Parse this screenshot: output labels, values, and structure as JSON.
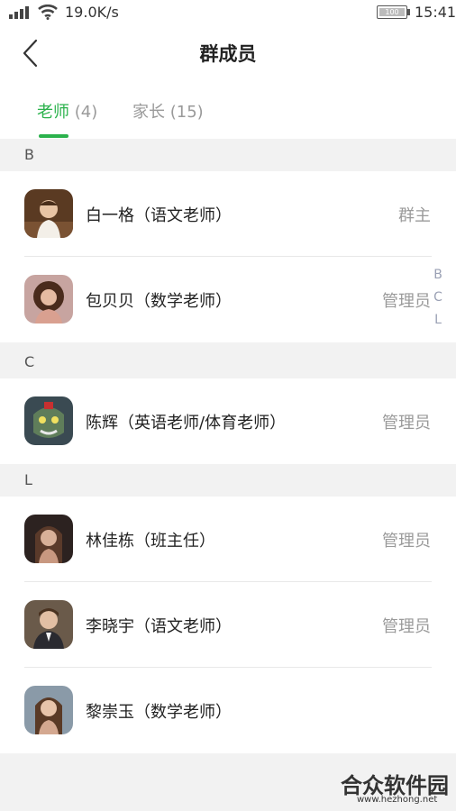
{
  "status_bar": {
    "speed": "19.0K/s",
    "battery": "100",
    "time": "15:41",
    "icons": [
      "signal-icon",
      "wifi-icon",
      "battery-icon"
    ]
  },
  "header": {
    "title": "群成员",
    "back_icon": "chevron-left-icon"
  },
  "tabs": [
    {
      "label": "老师",
      "count": "(4)",
      "active": true
    },
    {
      "label": "家长",
      "count": "(15)",
      "active": false
    }
  ],
  "sections": [
    {
      "letter": "B",
      "members": [
        {
          "name": "白一格（语文老师）",
          "role": "群主"
        },
        {
          "name": "包贝贝（数学老师）",
          "role": "管理员"
        }
      ]
    },
    {
      "letter": "C",
      "members": [
        {
          "name": "陈辉（英语老师/体育老师）",
          "role": "管理员"
        }
      ]
    },
    {
      "letter": "L",
      "members": [
        {
          "name": "林佳栋（班主任）",
          "role": "管理员"
        },
        {
          "name": "李晓宇（语文老师）",
          "role": "管理员"
        },
        {
          "name": "黎崇玉（数学老师）",
          "role": ""
        }
      ]
    }
  ],
  "index_bar": [
    "B",
    "C",
    "L"
  ],
  "watermark": {
    "title": "合众软件园",
    "url": "www.hezhong.net"
  },
  "colors": {
    "accent": "#2bb24c",
    "muted": "#9a9a9a",
    "background": "#f2f2f2"
  }
}
